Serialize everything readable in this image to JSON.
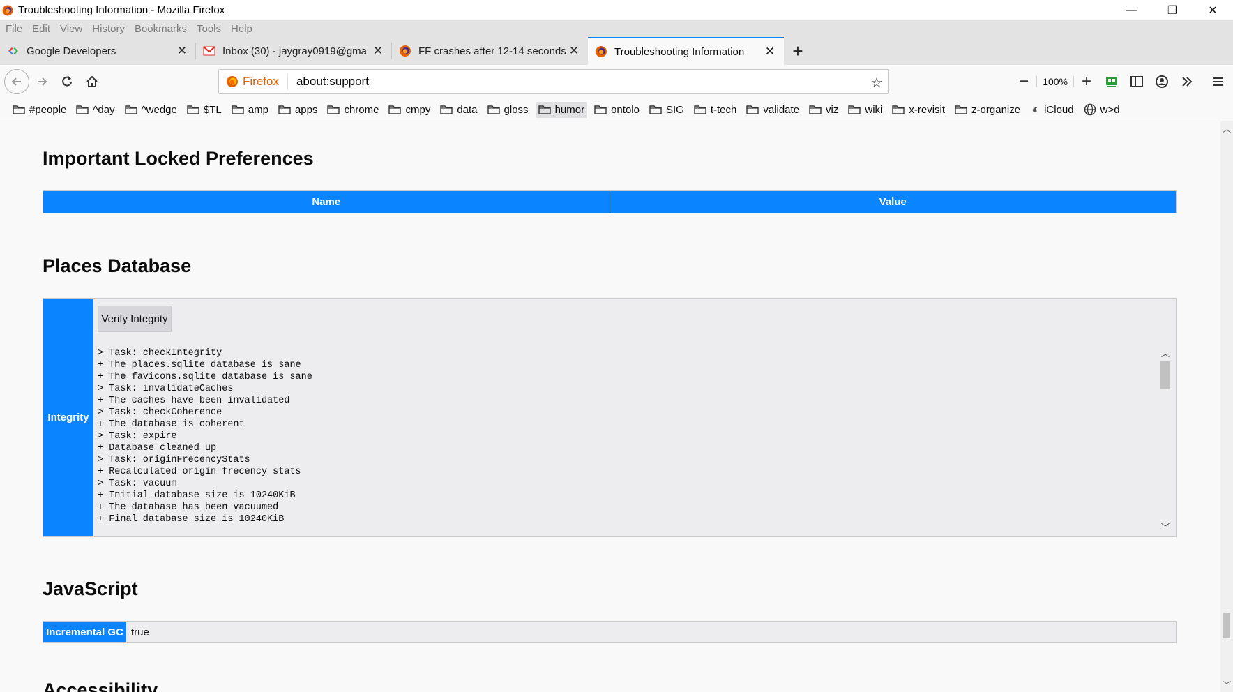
{
  "window": {
    "title": "Troubleshooting Information - Mozilla Firefox",
    "controls": {
      "minimize": "—",
      "restore": "❐",
      "close": "✕"
    }
  },
  "menu": [
    "File",
    "Edit",
    "View",
    "History",
    "Bookmarks",
    "Tools",
    "Help"
  ],
  "tabs": [
    {
      "label": "Google Developers",
      "icon": "google-developers-icon"
    },
    {
      "label": "Inbox (30) - jaygray0919@gma",
      "icon": "gmail-icon"
    },
    {
      "label": "FF crashes after 12-14 seconds",
      "icon": "firefox-icon"
    },
    {
      "label": "Troubleshooting Information",
      "icon": "firefox-icon",
      "active": true
    }
  ],
  "newtab_label": "+",
  "urlbar": {
    "identity_label": "Firefox",
    "url": "about:support"
  },
  "zoom": {
    "minus": "−",
    "level": "100%",
    "plus": "+"
  },
  "bookmarks": [
    "#people",
    "^day",
    "^wedge",
    "$TL",
    "amp",
    "apps",
    "chrome",
    "cmpy",
    "data",
    "gloss",
    "humor",
    "ontolo",
    "SIG",
    "t-tech",
    "validate",
    "viz",
    "wiki",
    "x-revisit",
    "z-organize",
    "iCloud",
    "w>d"
  ],
  "sections": {
    "locked_prefs": {
      "title": "Important Locked Preferences",
      "col_name": "Name",
      "col_value": "Value"
    },
    "places": {
      "title": "Places Database",
      "row_label": "Integrity",
      "button": "Verify Integrity",
      "log": [
        "> Task: checkIntegrity",
        "+ The places.sqlite database is sane",
        "+ The favicons.sqlite database is sane",
        "> Task: invalidateCaches",
        "+ The caches have been invalidated",
        "> Task: checkCoherence",
        "+ The database is coherent",
        "> Task: expire",
        "+ Database cleaned up",
        "> Task: originFrecencyStats",
        "+ Recalculated origin frecency stats",
        "> Task: vacuum",
        "+ Initial database size is 10240KiB",
        "+ The database has been vacuumed",
        "+ Final database size is 10240KiB"
      ]
    },
    "javascript": {
      "title": "JavaScript",
      "row_label": "Incremental GC",
      "row_value": "true"
    },
    "next": {
      "title": "Accessibility"
    }
  },
  "colors": {
    "accent": "#0a84ff",
    "firefox_orange": "#e66000"
  }
}
